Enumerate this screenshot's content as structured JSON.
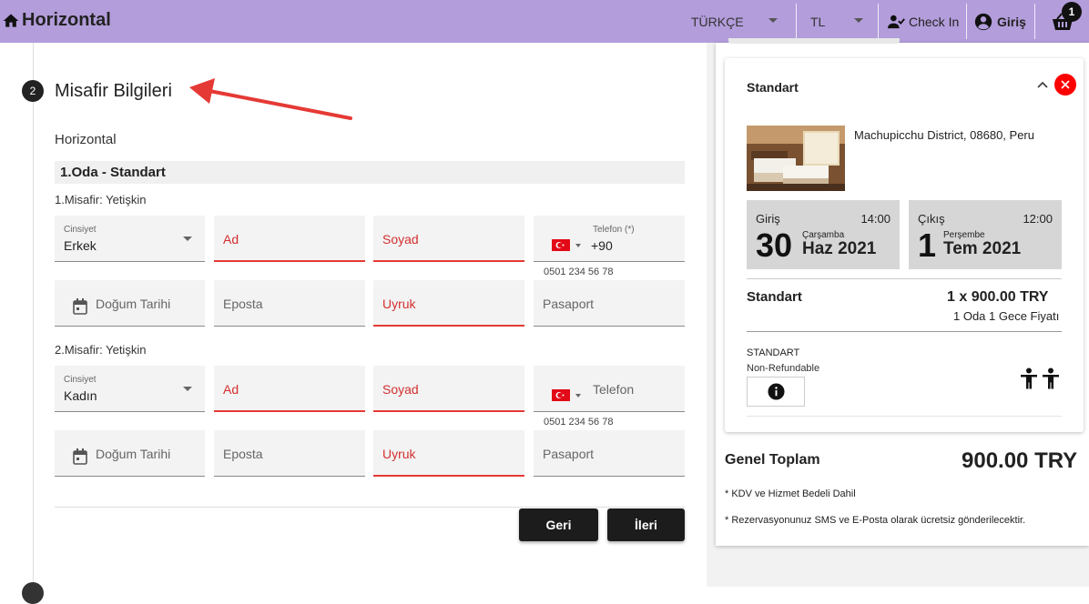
{
  "header": {
    "brand": "Horizontal",
    "language": "TÜRKÇE",
    "currency": "TL",
    "checkin_label": "Check In",
    "login_label": "Giriş",
    "cart_count": "1"
  },
  "form": {
    "step_number": "2",
    "step_title": "Misafir Bilgileri",
    "hotel_name": "Horizontal",
    "room_title": "1.Oda - Standart",
    "guests": [
      {
        "label": "1.Misafir: Yetişkin",
        "gender_label": "Cinsiyet",
        "gender_value": "Erkek",
        "first_name": "Ad",
        "last_name": "Soyad",
        "phone_label": "Telefon (*)",
        "phone_value": "+90",
        "phone_hint": "0501 234 56 78",
        "birth_date": "Doğum Tarihi",
        "email": "Eposta",
        "nationality": "Uyruk",
        "passport": "Pasaport"
      },
      {
        "label": "2.Misafir: Yetişkin",
        "gender_label": "Cinsiyet",
        "gender_value": "Kadın",
        "first_name": "Ad",
        "last_name": "Soyad",
        "phone_label": "Telefon",
        "phone_hint": "0501 234 56 78",
        "birth_date": "Doğum Tarihi",
        "email": "Eposta",
        "nationality": "Uyruk",
        "passport": "Pasaport"
      }
    ],
    "back_button": "Geri",
    "next_button": "İleri"
  },
  "summary": {
    "room_type": "Standart",
    "address": "Machupicchu District, 08680, Peru",
    "checkin": {
      "label": "Giriş",
      "time": "14:00",
      "day": "30",
      "weekday": "Çarşamba",
      "month_year": "Haz 2021"
    },
    "checkout": {
      "label": "Çıkış",
      "time": "12:00",
      "day": "1",
      "weekday": "Perşembe",
      "month_year": "Tem 2021"
    },
    "room_name": "Standart",
    "room_price": "1 x 900.00  TRY",
    "room_price_sub": "1 Oda 1 Gece Fiyatı",
    "rate_name": "STANDART",
    "rate_policy": "Non-Refundable",
    "total_label": "Genel Toplam",
    "total_value": "900.00 TRY",
    "note_1": "* KDV ve Hizmet Bedeli Dahil",
    "note_2": "* Rezervasyonunuz SMS ve E-Posta olarak ücretsiz gönderilecektir."
  },
  "colors": {
    "header_bg": "#b39ddb",
    "required_accent": "#e53935",
    "button_bg": "#1c1c1c",
    "close_red": "#ff0000"
  },
  "icons": [
    "home-icon",
    "chevron-down-icon",
    "person-check-icon",
    "account-circle-icon",
    "shopping-basket-icon",
    "calendar-icon",
    "turkey-flag-icon",
    "chevron-up-icon",
    "close-icon",
    "info-icon",
    "adult-person-icon",
    "red-arrow-annotation"
  ]
}
